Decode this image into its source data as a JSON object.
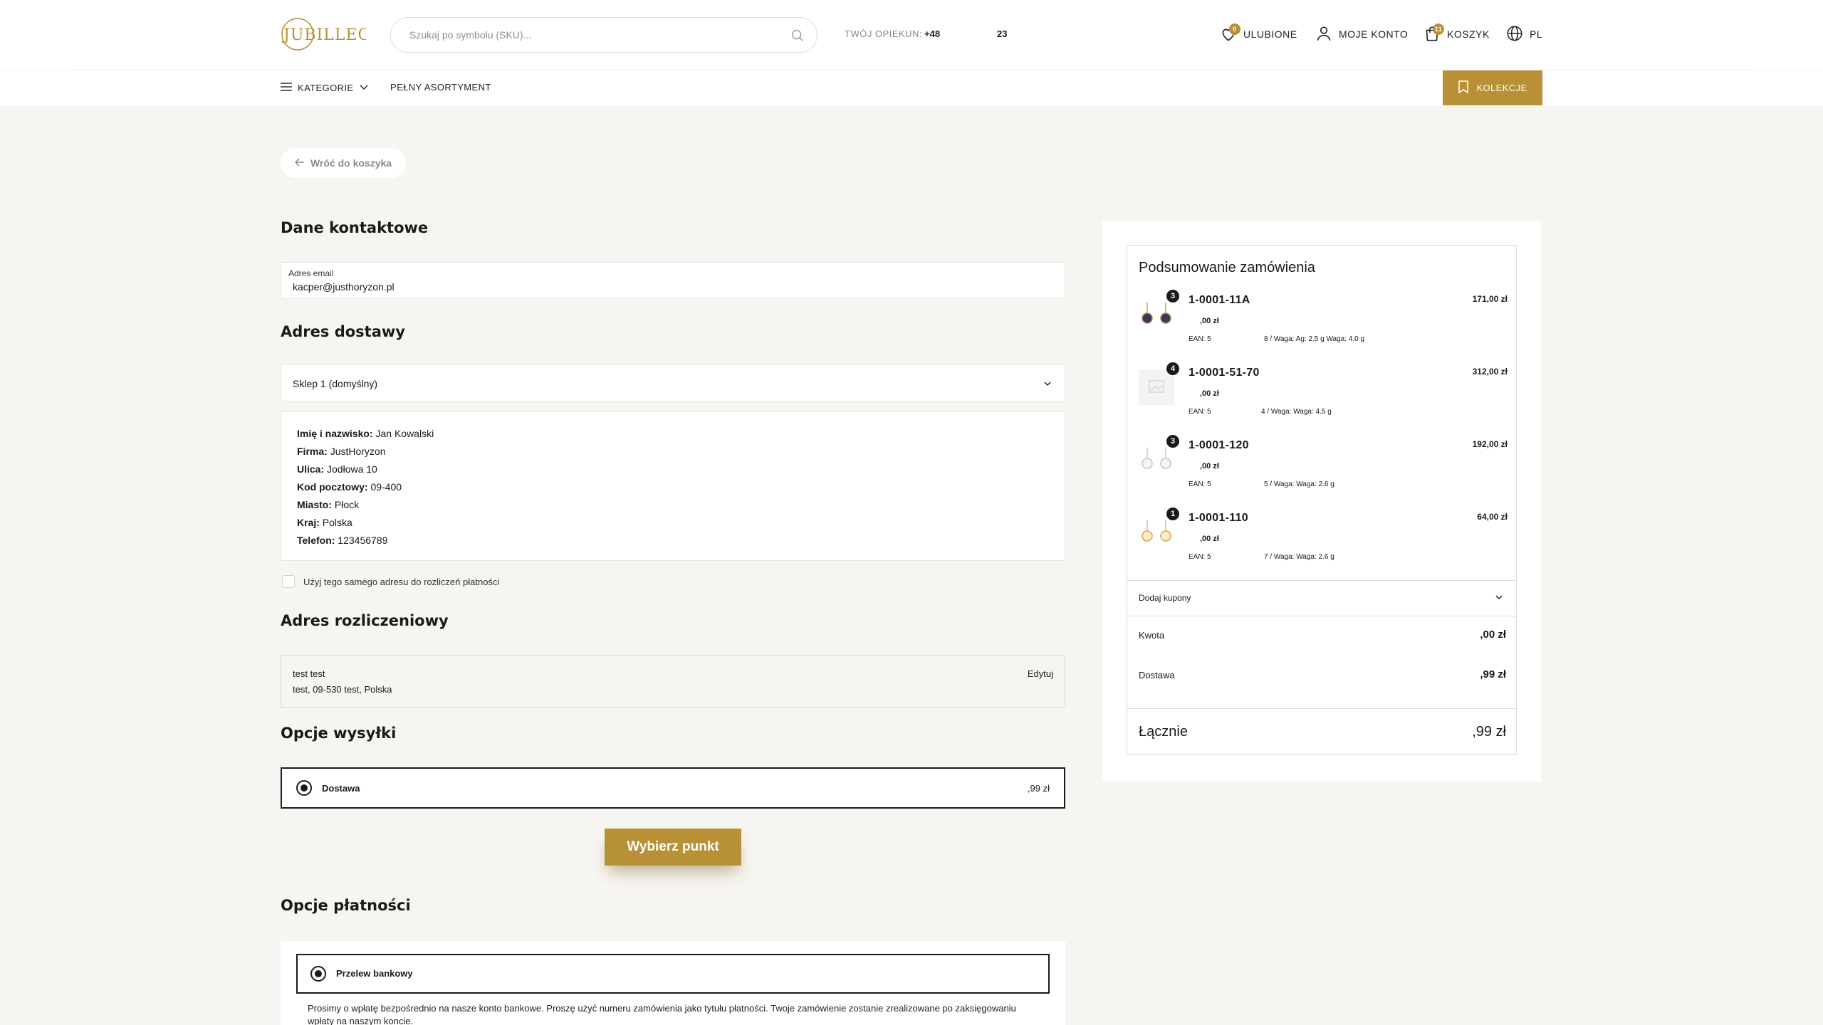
{
  "header": {
    "logo_text": "JUBILLEO",
    "search_placeholder": "Szukaj po symbolu (SKU)...",
    "carer_label": "TWÓJ OPIEKUN:",
    "carer_phone_prefix": "+48",
    "carer_phone_suffix": "23",
    "favorites_label": "ULUBIONE",
    "favorites_count": "0",
    "account_label": "MOJE KONTO",
    "cart_label": "KOSZYK",
    "cart_count": "11",
    "lang_label": "PL"
  },
  "nav": {
    "categories": "KATEGORIE",
    "assortment": "PEŁNY ASORTYMENT",
    "collections": "KOLEKCJE"
  },
  "back_label": "Wróć do koszyka",
  "contact": {
    "title": "Dane kontaktowe",
    "email_label": "Adres email",
    "email_value": "kacper@justhoryzon.pl"
  },
  "shipping_address": {
    "title": "Adres dostawy",
    "selected_store": "Sklep 1 (domyślny)",
    "lines": [
      {
        "label": "Imię i nazwisko:",
        "value": "Jan Kowalski"
      },
      {
        "label": "Firma:",
        "value": "JustHoryzon"
      },
      {
        "label": "Ulica:",
        "value": "Jodłowa 10"
      },
      {
        "label": "Kod pocztowy:",
        "value": "09-400"
      },
      {
        "label": "Miasto:",
        "value": "Płock"
      },
      {
        "label": "Kraj:",
        "value": "Polska"
      },
      {
        "label": "Telefon:",
        "value": "123456789"
      }
    ],
    "same_address_label": "Użyj tego samego adresu do rozliczeń płatności"
  },
  "billing": {
    "title": "Adres rozliczeniowy",
    "name": "test test",
    "address": "test, 09-530 test, Polska",
    "edit_label": "Edytuj"
  },
  "shipping_options": {
    "title": "Opcje wysyłki",
    "option_name": "Dostawa",
    "option_price": ",99 zł",
    "pick_point_label": "Wybierz punkt"
  },
  "payment": {
    "title": "Opcje płatności",
    "option_name": "Przelew bankowy",
    "description": "Prosimy o wpłatę bezpośrednio na nasze konto bankowe. Proszę użyć numeru zamówienia jako tytułu płatności. Twoje zamówienie zostanie zrealizowane po zaksięgowaniu wpłaty na naszym koncie."
  },
  "summary": {
    "title": "Podsumowanie zamówienia",
    "products": [
      {
        "qty": "3",
        "sku": "1-0001-11A",
        "price": "171,00 zł",
        "unit": ",00 zł",
        "ean": "EAN: 5",
        "details": "8 / Waga: Ag: 2.5 g Waga: 4.0 g",
        "thumb": "dark"
      },
      {
        "qty": "4",
        "sku": "1-0001-51-70",
        "price": "312,00 zł",
        "unit": ",00 zł",
        "ean": "EAN: 5",
        "details": "4 / Waga: Waga: 4.5 g",
        "thumb": "placeholder"
      },
      {
        "qty": "3",
        "sku": "1-0001-120",
        "price": "192,00 zł",
        "unit": ",00 zł",
        "ean": "EAN: 5",
        "details": "5 / Waga: Waga: 2.6 g",
        "thumb": "silver"
      },
      {
        "qty": "1",
        "sku": "1-0001-110",
        "price": "64,00 zł",
        "unit": ",00 zł",
        "ean": "EAN: 5",
        "details": "7 / Waga: Waga: 2.6 g",
        "thumb": "gold"
      }
    ],
    "coupon_label": "Dodaj kupony",
    "amount_label": "Kwota",
    "amount_value": ",00 zł",
    "delivery_label": "Dostawa",
    "delivery_value": ",99 zł",
    "total_label": "Łącznie",
    "total_value": ",99 zł"
  },
  "colors": {
    "accent": "#b89035",
    "background": "#f7f5f1",
    "text": "#1a1a1a"
  }
}
